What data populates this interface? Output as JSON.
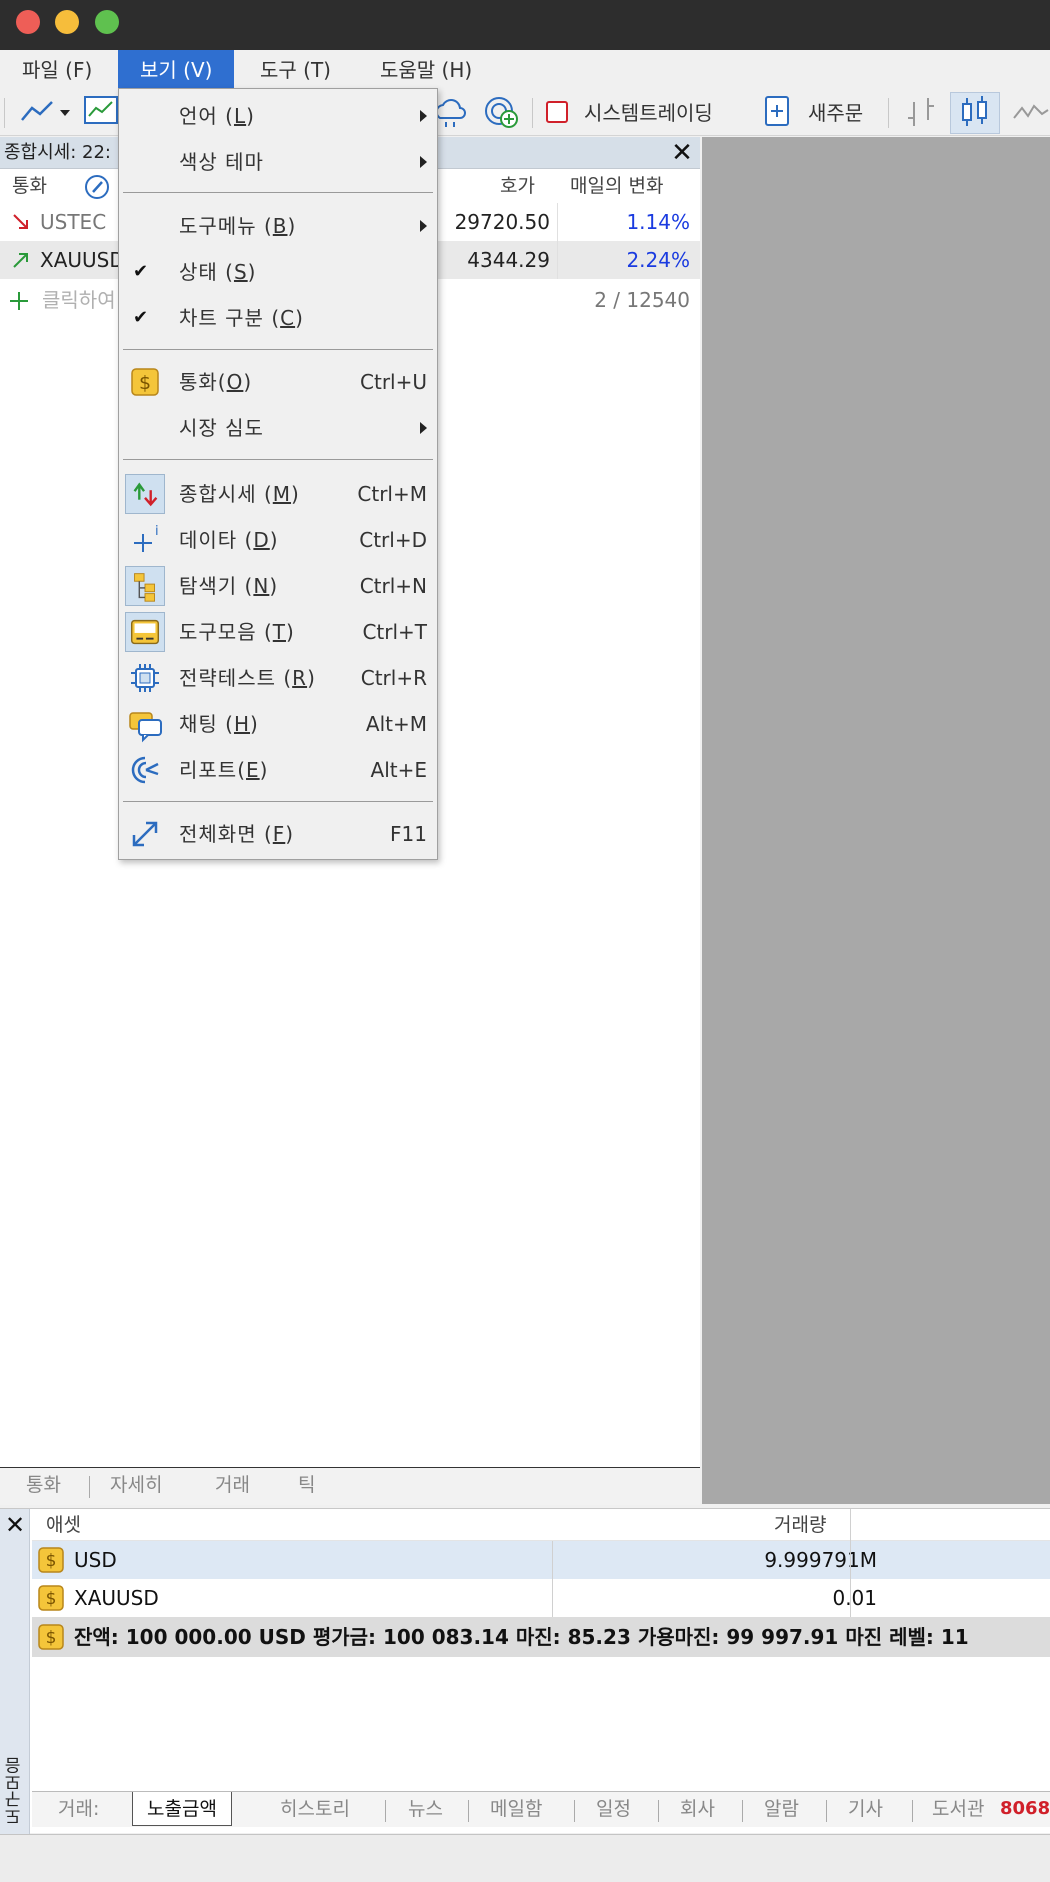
{
  "menubar": {
    "file": "파일 (F)",
    "view": "보기 (V)",
    "tools": "도구 (T)",
    "help": "도움말 (H)"
  },
  "toolbar": {
    "system_trading": "시스템트레이딩",
    "new_order": "새주문"
  },
  "market_watch": {
    "title": "종합시세: 22:",
    "close": "✕",
    "col_symbol": "통화",
    "col_bid": "호가",
    "col_change": "매일의 변화",
    "rows": [
      {
        "symbol": "USTEC",
        "bid": "29720.50",
        "change": "1.14%",
        "direction": "down"
      },
      {
        "symbol": "XAUUSD",
        "bid": "4344.29",
        "change": "2.24%",
        "direction": "up"
      }
    ],
    "add_label": "클릭하여",
    "count": "2 / 12540",
    "tabs": [
      "통화",
      "자세히",
      "거래",
      "틱"
    ]
  },
  "view_menu": {
    "items": [
      {
        "label": "언어 (",
        "ul": "L",
        "tail": ")",
        "submenu": true
      },
      {
        "label": "색상 테마",
        "submenu": true
      },
      {
        "label": "도구메뉴 (",
        "ul": "B",
        "tail": ")",
        "submenu": true
      },
      {
        "label": "상태 (",
        "ul": "S",
        "tail": ")",
        "checked": true
      },
      {
        "label": "차트 구분 (",
        "ul": "C",
        "tail": ")",
        "checked": true
      },
      {
        "label": "통화(",
        "ul": "O",
        "tail": ")",
        "shortcut": "Ctrl+U"
      },
      {
        "label": "시장 심도",
        "submenu": true
      },
      {
        "label": "종합시세 (",
        "ul": "M",
        "tail": ")",
        "shortcut": "Ctrl+M"
      },
      {
        "label": "데이타 (",
        "ul": "D",
        "tail": ")",
        "shortcut": "Ctrl+D"
      },
      {
        "label": "탐색기 (",
        "ul": "N",
        "tail": ")",
        "shortcut": "Ctrl+N"
      },
      {
        "label": "도구모음 (",
        "ul": "T",
        "tail": ")",
        "shortcut": "Ctrl+T"
      },
      {
        "label": "전략테스트 (",
        "ul": "R",
        "tail": ")",
        "shortcut": "Ctrl+R"
      },
      {
        "label": "채팅 (",
        "ul": "H",
        "tail": ")",
        "shortcut": "Alt+M"
      },
      {
        "label": "리포트(",
        "ul": "E",
        "tail": ")",
        "shortcut": "Alt+E"
      },
      {
        "label": "전체화면 (",
        "ul": "F",
        "tail": ")",
        "shortcut": "F11"
      }
    ]
  },
  "toolbox": {
    "side_label": "도구모음",
    "close": "✕",
    "col_asset": "애셋",
    "col_volume": "거래량",
    "rows": [
      {
        "asset": "USD",
        "volume": "9.999791M"
      },
      {
        "asset": "XAUUSD",
        "volume": "0.01"
      }
    ],
    "summary": "잔액: 100 000.00 USD  평가금: 100 083.14  마진: 85.23  가용마진: 99 997.91  마진 레벨: 11",
    "tabs": [
      "거래:",
      "노출금액",
      "히스토리",
      "뉴스",
      "메일함",
      "일정",
      "회사",
      "알람",
      "기사",
      "도서관"
    ],
    "badge": "8068"
  },
  "colors": {
    "accent": "#2f6fd0",
    "change_text": "#1a3be0",
    "arrow_down": "#d0202a",
    "arrow_up": "#2a9a3a",
    "badge": "#d0202a"
  }
}
